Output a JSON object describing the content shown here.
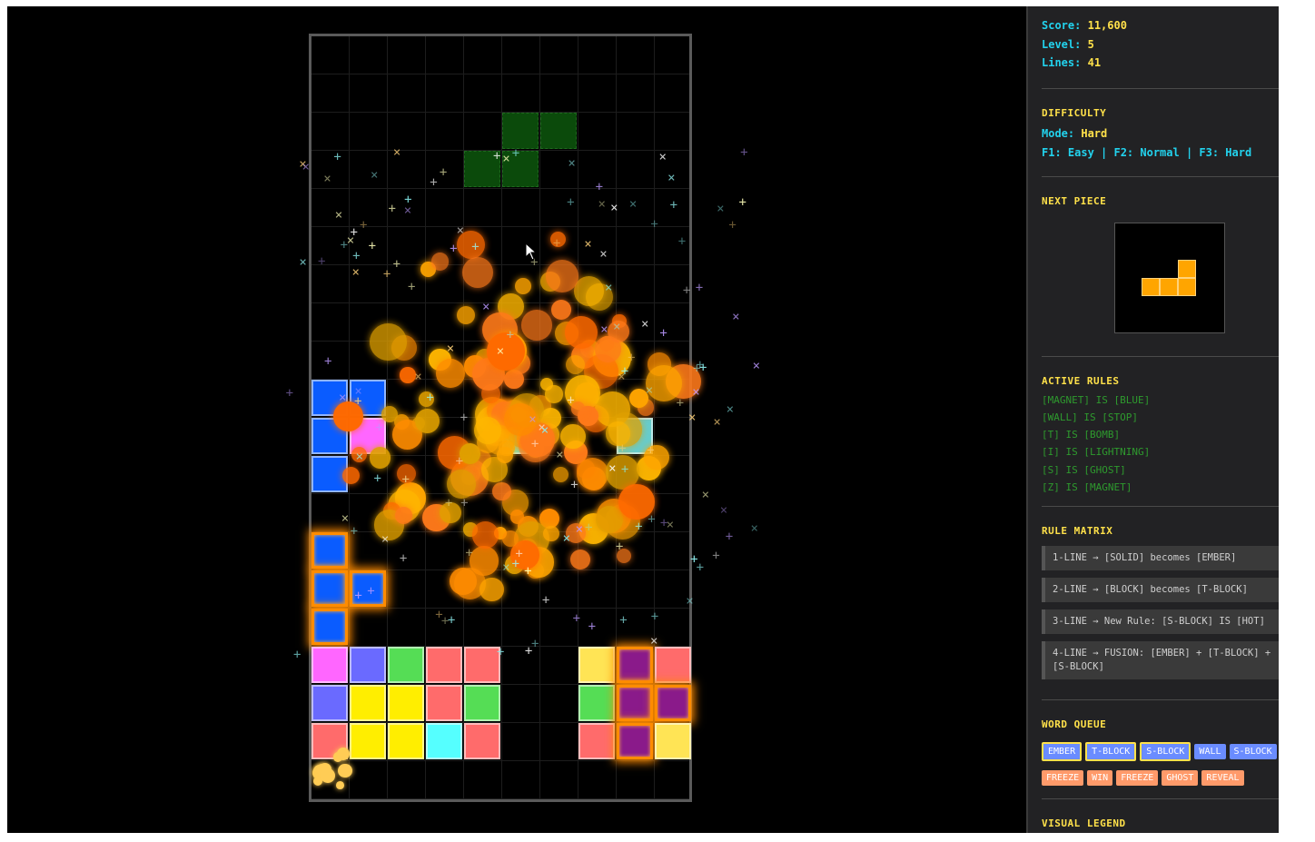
{
  "stats": {
    "score_label": "Score:",
    "score": "11,600",
    "level_label": "Level:",
    "level": "5",
    "lines_label": "Lines:",
    "lines": "41"
  },
  "difficulty": {
    "title": "DIFFICULTY",
    "mode_label": "Mode:",
    "mode": "Hard",
    "keys": "F1: Easy | F2: Normal | F3: Hard"
  },
  "next_piece": {
    "title": "NEXT PIECE",
    "color": "#ffa500",
    "shape": "L"
  },
  "active_rules": {
    "title": "ACTIVE RULES",
    "items": [
      "[MAGNET] IS [BLUE]",
      "[WALL] IS [STOP]",
      "[T] IS [BOMB]",
      "[I] IS [LIGHTNING]",
      "[S] IS [GHOST]",
      "[Z] IS [MAGNET]"
    ]
  },
  "rule_matrix": {
    "title": "RULE MATRIX",
    "items": [
      "1-LINE → [SOLID] becomes [EMBER]",
      "2-LINE → [BLOCK] becomes [T-BLOCK]",
      "3-LINE → New Rule: [S-BLOCK] IS [HOT]",
      "4-LINE → FUSION: [EMBER] + [T-BLOCK] + [S-BLOCK]"
    ]
  },
  "word_queue": {
    "title": "WORD QUEUE",
    "row1": [
      "EMBER",
      "T-BLOCK",
      "S-BLOCK",
      "WALL",
      "S-BLOCK"
    ],
    "row2": [
      "FREEZE",
      "WIN",
      "FREEZE",
      "GHOST",
      "REVEAL"
    ]
  },
  "visual_legend": {
    "title": "VISUAL LEGEND"
  },
  "colors": {
    "blue": "#0a5cff",
    "magenta": "#ff66ff",
    "periwinkle": "#6a6aff",
    "green": "#55dd55",
    "salmon": "#ff6b6b",
    "yellow": "#ffee00",
    "cyan": "#55ffff",
    "purple": "#8a1a8a",
    "lightyellow": "#ffe455",
    "ember_orange": "#ff8c00",
    "ghost_green": "#0b4a0b"
  }
}
